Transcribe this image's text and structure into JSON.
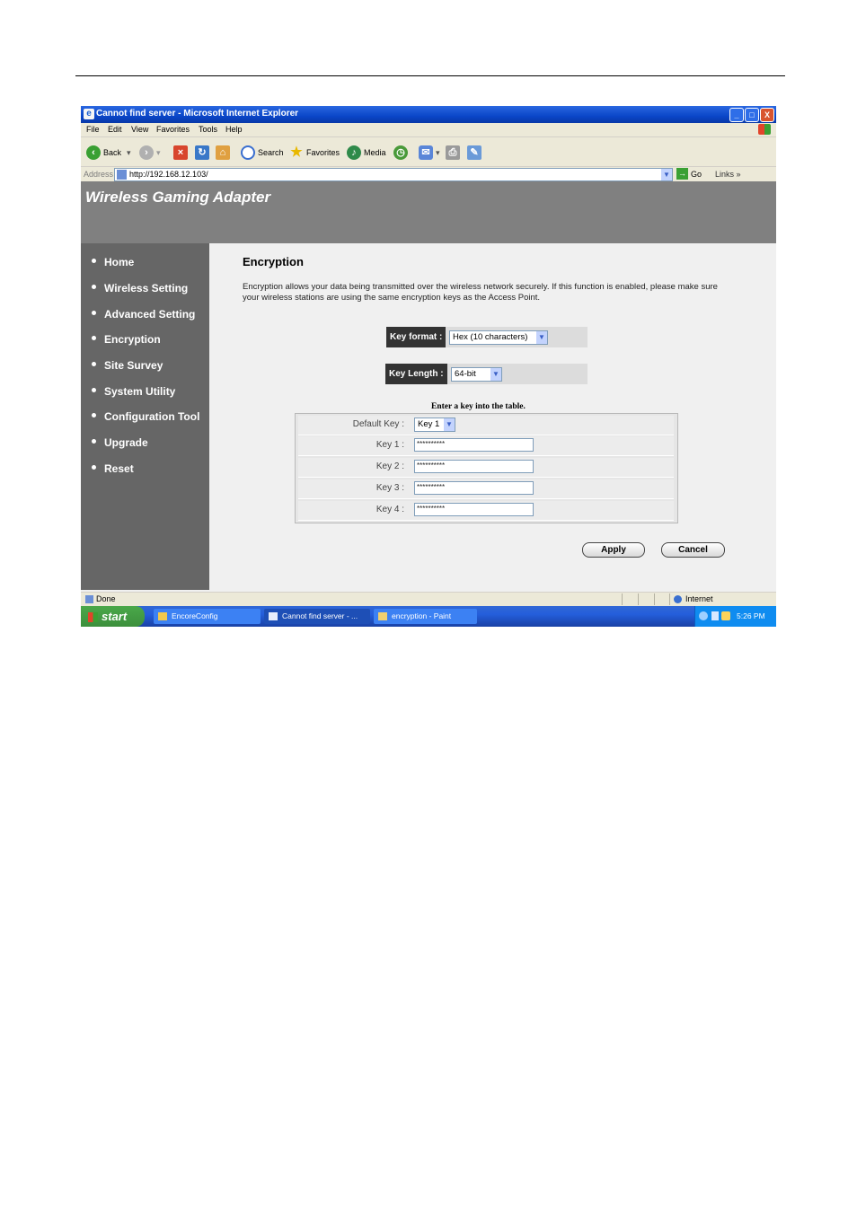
{
  "window": {
    "title": "Cannot find server - Microsoft Internet Explorer",
    "controls": {
      "minimize": "_",
      "maximize": "□",
      "close": "X"
    }
  },
  "menu": [
    "File",
    "Edit",
    "View",
    "Favorites",
    "Tools",
    "Help"
  ],
  "toolbar": {
    "back": "Back",
    "search": "Search",
    "favorites": "Favorites",
    "media": "Media"
  },
  "address": {
    "label": "Address",
    "url": "http://192.168.12.103/",
    "go": "Go",
    "links": "Links"
  },
  "brand": "Wireless Gaming Adapter",
  "nav": [
    "Home",
    "Wireless Setting",
    "Advanced Setting",
    "Encryption",
    "Site Survey",
    "System Utility",
    "Configuration Tool",
    "Upgrade",
    "Reset"
  ],
  "main": {
    "title": "Encryption",
    "description": "Encryption allows your data being transmitted over the wireless network securely. If this function is enabled, please make sure your wireless stations are using the same encryption keys as the Access Point.",
    "key_format": {
      "label": "Key format :",
      "value": "Hex (10 characters)"
    },
    "key_length": {
      "label": "Key Length :",
      "value": "64-bit"
    },
    "table_caption": "Enter a key into the table.",
    "default_key": {
      "label": "Default Key :",
      "value": "Key 1"
    },
    "keys": [
      {
        "label": "Key 1 :",
        "value": "**********"
      },
      {
        "label": "Key 2 :",
        "value": "**********"
      },
      {
        "label": "Key 3 :",
        "value": "**********"
      },
      {
        "label": "Key 4 :",
        "value": "**********"
      }
    ],
    "apply": "Apply",
    "cancel": "Cancel"
  },
  "status": {
    "text": "Done",
    "zone": "Internet"
  },
  "taskbar": {
    "start": "start",
    "tasks": [
      "EncoreConfig",
      "Cannot find server - ...",
      "encryption - Paint"
    ],
    "clock": "5:26 PM"
  }
}
